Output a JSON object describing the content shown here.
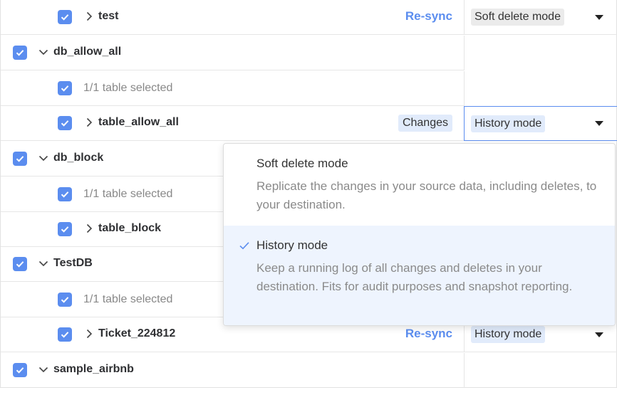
{
  "rows": {
    "test": {
      "name": "test",
      "action": "Re-sync",
      "mode": "Soft delete mode"
    },
    "db_allow_all": {
      "name": "db_allow_all"
    },
    "db_allow_all_count": {
      "text": "1/1 table selected"
    },
    "table_allow_all": {
      "name": "table_allow_all",
      "action": "Changes",
      "mode": "History mode"
    },
    "db_block": {
      "name": "db_block"
    },
    "db_block_count": {
      "text": "1/1 table selected"
    },
    "table_block": {
      "name": "table_block"
    },
    "testdb": {
      "name": "TestDB"
    },
    "testdb_count": {
      "text": "1/1 table selected"
    },
    "ticket": {
      "name": "Ticket_224812",
      "action": "Re-sync",
      "mode": "History mode"
    },
    "sample_airbnb": {
      "name": "sample_airbnb"
    }
  },
  "dropdown": {
    "options": [
      {
        "title": "Soft delete mode",
        "description": "Replicate the changes in your source data, including deletes, to your destination.",
        "selected": false
      },
      {
        "title": "History mode",
        "description": "Keep a running log of all changes and deletes in your destination. Fits for audit purposes and snapshot reporting.",
        "selected": true
      }
    ]
  },
  "colors": {
    "accent": "#5b8def",
    "highlight": "#e1ebfb",
    "selected_option": "#eef4fe"
  },
  "icons": {
    "checkbox": "check-icon",
    "expand": "chevron-right-icon",
    "collapse": "chevron-down-icon",
    "dropdown": "caret-down-icon"
  }
}
